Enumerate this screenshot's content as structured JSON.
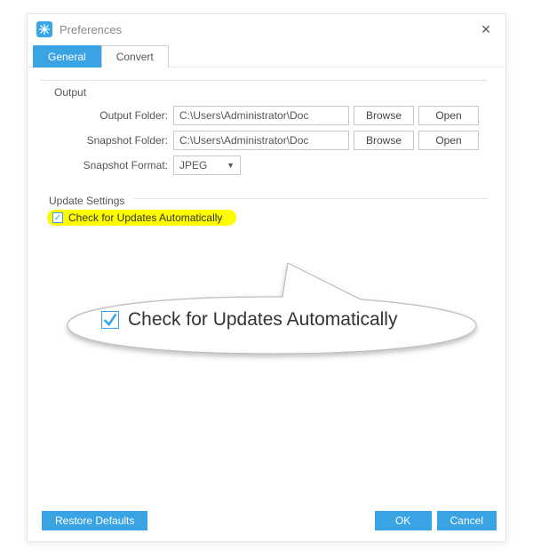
{
  "window": {
    "title": "Preferences"
  },
  "tabs": {
    "general": "General",
    "convert": "Convert"
  },
  "output": {
    "group_label": "Output",
    "folder_label": "Output Folder:",
    "folder_value": "C:\\Users\\Administrator\\Doc",
    "snapshot_folder_label": "Snapshot Folder:",
    "snapshot_folder_value": "C:\\Users\\Administrator\\Doc",
    "snapshot_format_label": "Snapshot Format:",
    "snapshot_format_value": "JPEG",
    "browse": "Browse",
    "open": "Open"
  },
  "update": {
    "group_label": "Update Settings",
    "check_auto": "Check for Updates Automatically"
  },
  "callout": {
    "text": "Check for Updates Automatically"
  },
  "footer": {
    "restore": "Restore Defaults",
    "ok": "OK",
    "cancel": "Cancel"
  }
}
